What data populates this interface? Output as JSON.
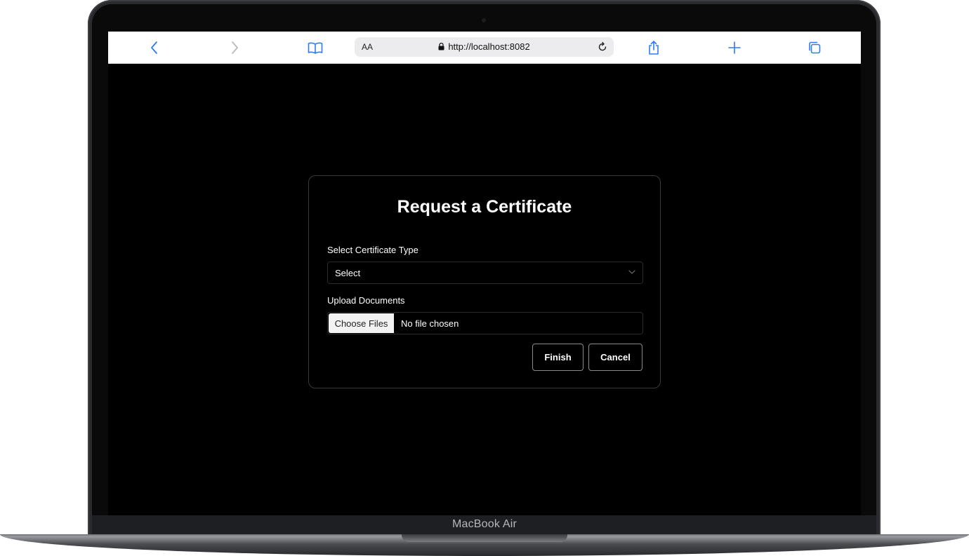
{
  "browser": {
    "address_bar": {
      "text_size_label": "AA",
      "url": "http://localhost:8082"
    },
    "icons": [
      "chevron-left-icon",
      "chevron-right-icon",
      "book-icon",
      "lock-icon",
      "reload-icon",
      "share-icon",
      "plus-icon",
      "tabs-icon"
    ]
  },
  "dialog": {
    "title": "Request a Certificate",
    "certificate_type": {
      "label": "Select Certificate Type",
      "selected_value": "Select"
    },
    "upload": {
      "label": "Upload Documents",
      "choose_button_label": "Choose Files",
      "status": "No file chosen"
    },
    "actions": {
      "finish_label": "Finish",
      "cancel_label": "Cancel"
    }
  },
  "device": {
    "model_label": "MacBook Air"
  },
  "colors": {
    "screen_background": "#000000",
    "toolbar_icon": "#2f7bf5",
    "dialog_border": "#3a3a3a"
  }
}
